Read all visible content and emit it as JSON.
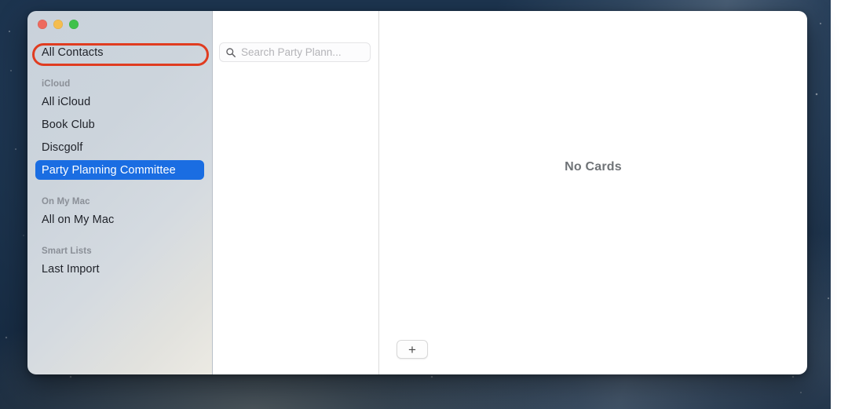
{
  "window": {
    "traffic_lights": [
      {
        "name": "close",
        "color": "#ee6a5e"
      },
      {
        "name": "minimize",
        "color": "#f5bd4f"
      },
      {
        "name": "zoom",
        "color": "#3fc14a"
      }
    ]
  },
  "sidebar": {
    "top_item": {
      "label": "All Contacts",
      "highlighted": true,
      "highlight_color": "#e03c20"
    },
    "sections": [
      {
        "header": "iCloud",
        "items": [
          {
            "label": "All iCloud",
            "selected": false
          },
          {
            "label": "Book Club",
            "selected": false
          },
          {
            "label": "Discgolf",
            "selected": false
          },
          {
            "label": "Party Planning Committee",
            "selected": true
          }
        ]
      },
      {
        "header": "On My Mac",
        "items": [
          {
            "label": "All on My Mac",
            "selected": false
          }
        ]
      },
      {
        "header": "Smart Lists",
        "items": [
          {
            "label": "Last Import",
            "selected": false
          }
        ]
      }
    ],
    "selected_color": "#1a6de2"
  },
  "list_pane": {
    "search": {
      "icon": "search-icon",
      "value": "",
      "placeholder": "Search Party Plann..."
    }
  },
  "detail_pane": {
    "empty_state": "No Cards"
  },
  "toolbar": {
    "add_label": "+"
  }
}
